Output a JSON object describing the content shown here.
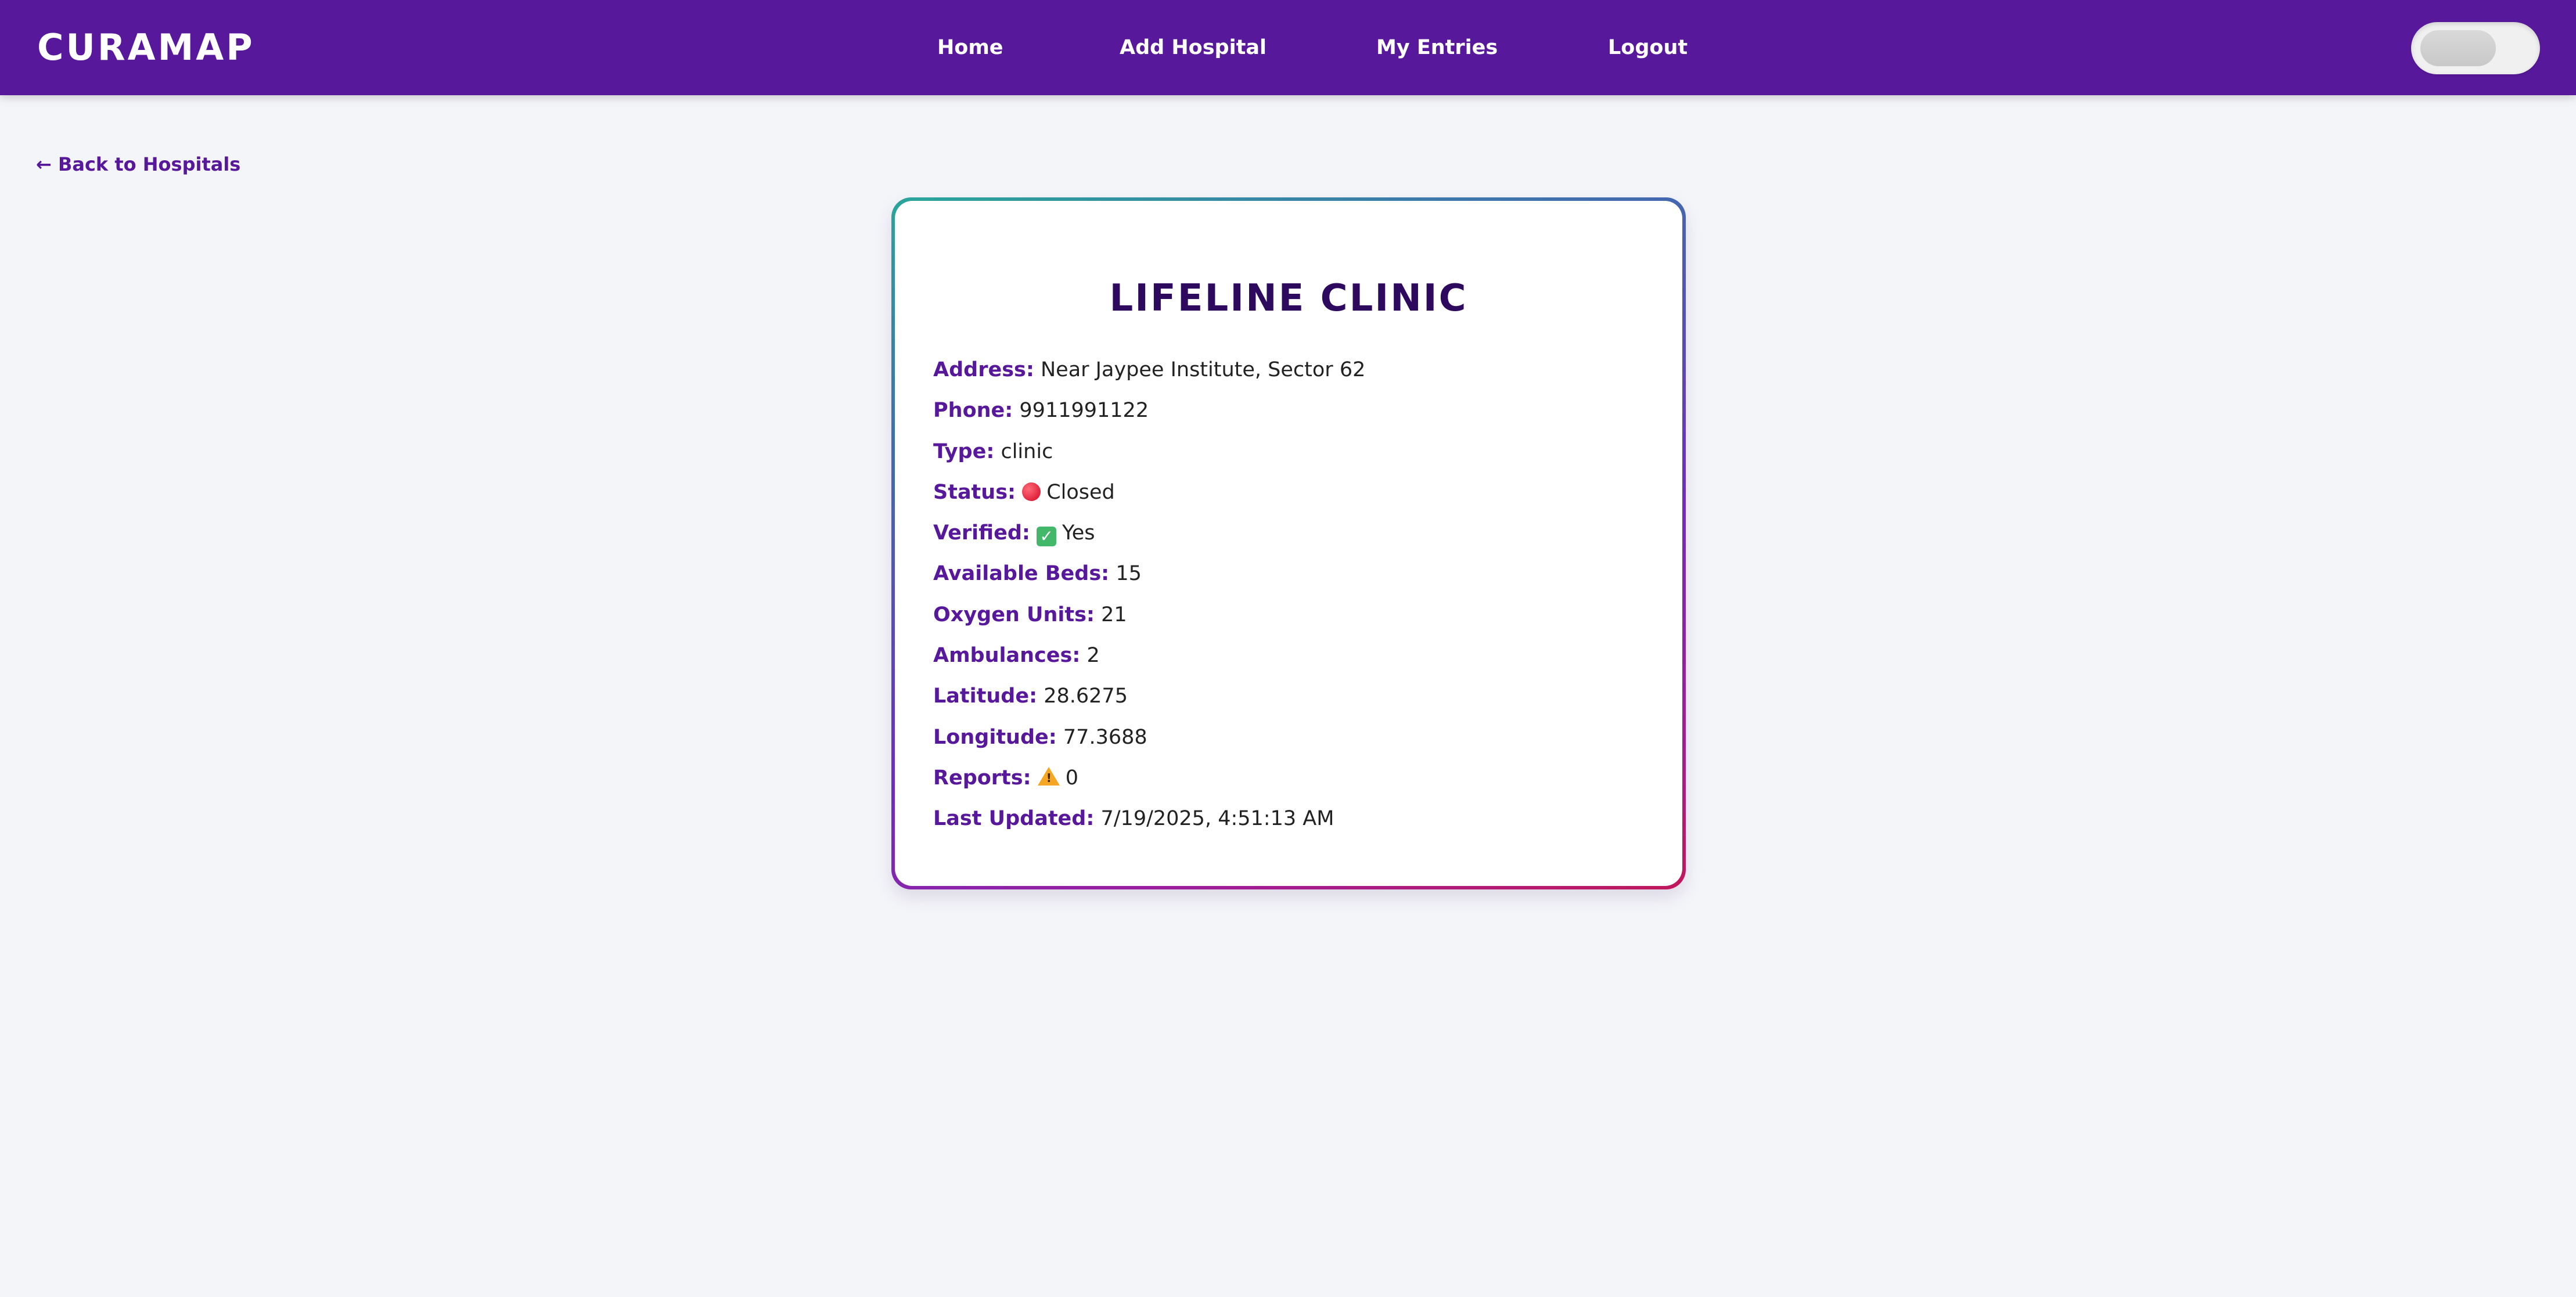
{
  "navbar": {
    "logo": "CURAMAP",
    "links": [
      {
        "label": "Home"
      },
      {
        "label": "Add Hospital"
      },
      {
        "label": "My Entries"
      },
      {
        "label": "Logout"
      }
    ],
    "theme_toggle_on": false
  },
  "back_link": "← Back to Hospitals",
  "hospital": {
    "name": "Lifeline Clinic",
    "fields": [
      {
        "label": "Address:",
        "value": "Near Jaypee Institute, Sector 62"
      },
      {
        "label": "Phone:",
        "value": "9911991122"
      },
      {
        "label": "Type:",
        "value": "clinic"
      },
      {
        "label": "Status:",
        "icon": "red-circle-icon",
        "value": "Closed"
      },
      {
        "label": "Verified:",
        "icon": "check-mark-icon",
        "value": "Yes"
      },
      {
        "label": "Available Beds:",
        "value": "15"
      },
      {
        "label": "Oxygen Units:",
        "value": "21"
      },
      {
        "label": "Ambulances:",
        "value": "2"
      },
      {
        "label": "Latitude:",
        "value": "28.6275"
      },
      {
        "label": "Longitude:",
        "value": "77.3688"
      },
      {
        "label": "Reports:",
        "icon": "warning-icon",
        "value": "0"
      },
      {
        "label": "Last Updated:",
        "value": "7/19/2025, 4:51:13 AM"
      }
    ]
  },
  "colors": {
    "navbar_bg": "#58189b",
    "label": "#58189b",
    "title": "#2d0a5e",
    "page_bg": "#f4f5f9"
  }
}
